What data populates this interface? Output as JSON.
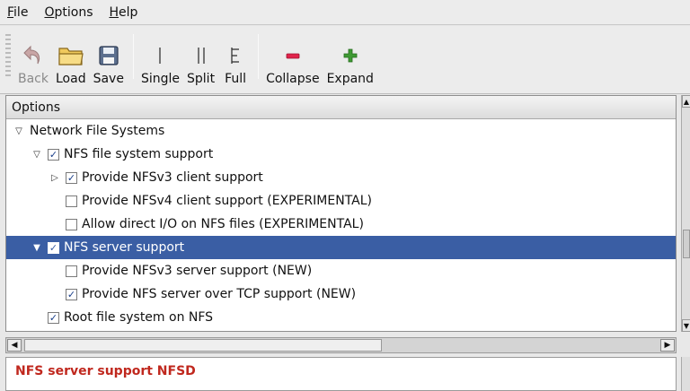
{
  "menu": [
    {
      "label": "File",
      "underline": "F",
      "rest": "ile"
    },
    {
      "label": "Options",
      "underline": "O",
      "rest": "ptions"
    },
    {
      "label": "Help",
      "underline": "H",
      "rest": "elp"
    }
  ],
  "toolbar": {
    "back": "Back",
    "load": "Load",
    "save": "Save",
    "single": "Single",
    "split": "Split",
    "full": "Full",
    "collapse": "Collapse",
    "expand": "Expand"
  },
  "tree": {
    "header": "Options",
    "rows": [
      {
        "label": "Network File Systems",
        "checked": null,
        "expander": "open",
        "level": 1,
        "selected": false
      },
      {
        "label": "NFS file system support",
        "checked": true,
        "expander": "open",
        "level": 2,
        "selected": false
      },
      {
        "label": "Provide NFSv3 client support",
        "checked": true,
        "expander": "closed",
        "level": 3,
        "selected": false
      },
      {
        "label": "Provide NFSv4 client support (EXPERIMENTAL)",
        "checked": false,
        "expander": "none",
        "level": 3,
        "selected": false
      },
      {
        "label": "Allow direct I/O on NFS files (EXPERIMENTAL)",
        "checked": false,
        "expander": "none",
        "level": 3,
        "selected": false
      },
      {
        "label": "NFS server support",
        "checked": true,
        "expander": "open",
        "level": 2,
        "selected": true
      },
      {
        "label": "Provide NFSv3 server support (NEW)",
        "checked": false,
        "expander": "none",
        "level": 3,
        "selected": false
      },
      {
        "label": "Provide NFS server over TCP support (NEW)",
        "checked": true,
        "expander": "none",
        "level": 3,
        "selected": false
      },
      {
        "label": "Root file system on NFS",
        "checked": true,
        "expander": "none",
        "level": 2,
        "selected": false
      }
    ]
  },
  "help": {
    "text": "NFS server support NFSD"
  },
  "colors": {
    "selection": "#3a5ea4",
    "help_text": "#c0281e",
    "collapse_icon": "#e0234a",
    "expand_icon": "#3f9a34"
  }
}
